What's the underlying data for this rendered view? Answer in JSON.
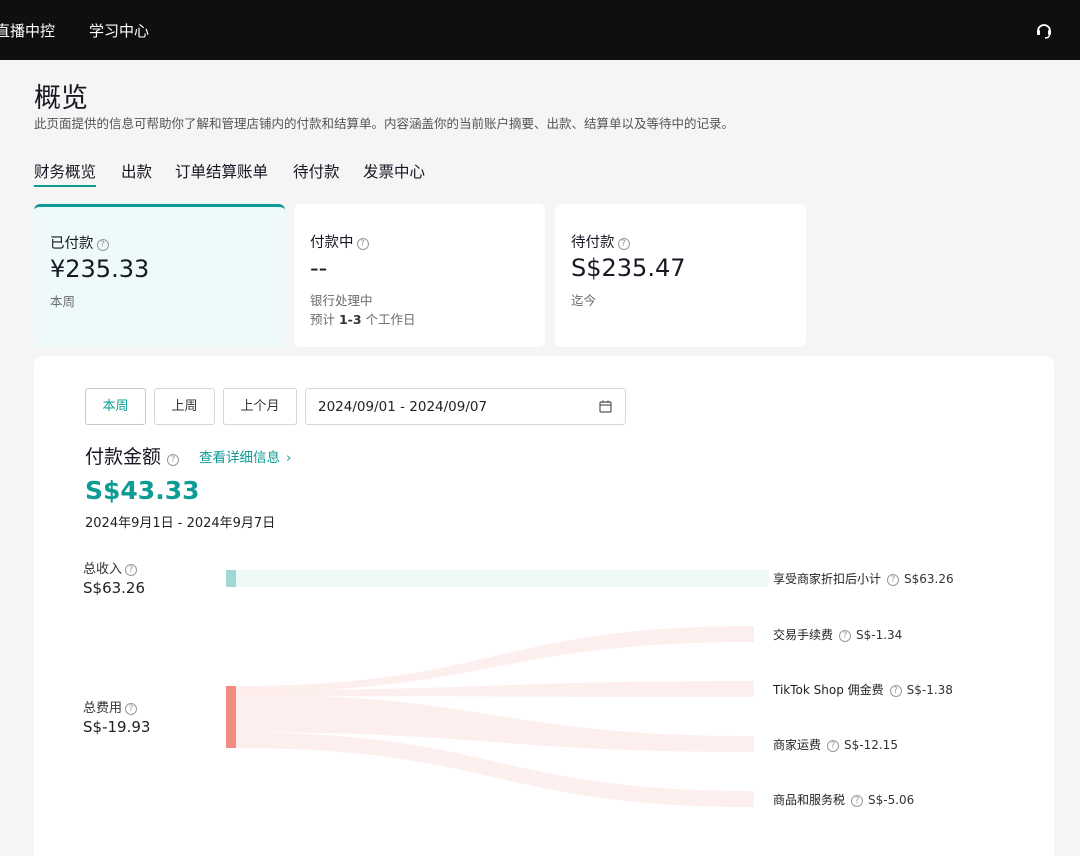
{
  "topbar": {
    "nav": [
      "直播中控",
      "学习中心"
    ],
    "support_icon": "headset-icon"
  },
  "page": {
    "title": "概览",
    "description": "此页面提供的信息可帮助你了解和管理店铺内的付款和结算单。内容涵盖你的当前账户摘要、出款、结算单以及等待中的记录。"
  },
  "tabs": [
    "财务概览",
    "出款",
    "订单结算账单",
    "待付款",
    "发票中心"
  ],
  "cards": [
    {
      "label": "已付款",
      "value": "¥235.33",
      "sub1": "本周",
      "sub2": ""
    },
    {
      "label": "付款中",
      "value": "--",
      "sub1": "银行处理中",
      "sub2_prefix": "预计 ",
      "sub2_bold": "1-3",
      "sub2_suffix": " 个工作日"
    },
    {
      "label": "待付款",
      "value": "S$235.47",
      "sub1": "迄今",
      "sub2": ""
    }
  ],
  "filters": {
    "periods": [
      "本周",
      "上周",
      "上个月"
    ],
    "date_range": "2024/09/01 - 2024/09/07"
  },
  "payment": {
    "title": "付款金额",
    "detail_link": "查看详细信息",
    "amount": "S$43.33",
    "range_text": "2024年9月1日 - 2024年9月7日"
  },
  "breakdown": {
    "income": {
      "label": "总收入",
      "value": "S$63.26"
    },
    "expense": {
      "label": "总费用",
      "value": "S$-19.93"
    },
    "flows": [
      {
        "label": "享受商家折扣后小计",
        "value": "S$63.26",
        "amount": 63.26
      },
      {
        "label": "交易手续费",
        "value": "S$-1.34",
        "amount": -1.34
      },
      {
        "label": "TikTok Shop 佣金费",
        "value": "S$-1.38",
        "amount": -1.38
      },
      {
        "label": "商家运费",
        "value": "S$-12.15",
        "amount": -12.15
      },
      {
        "label": "商品和服务税",
        "value": "S$-5.06",
        "amount": -5.06
      }
    ],
    "colors": {
      "income": "#9fd8d4",
      "income_flow": "#eef9f8",
      "expense": "#f28b82",
      "expense_flow": "#fdecea"
    }
  }
}
